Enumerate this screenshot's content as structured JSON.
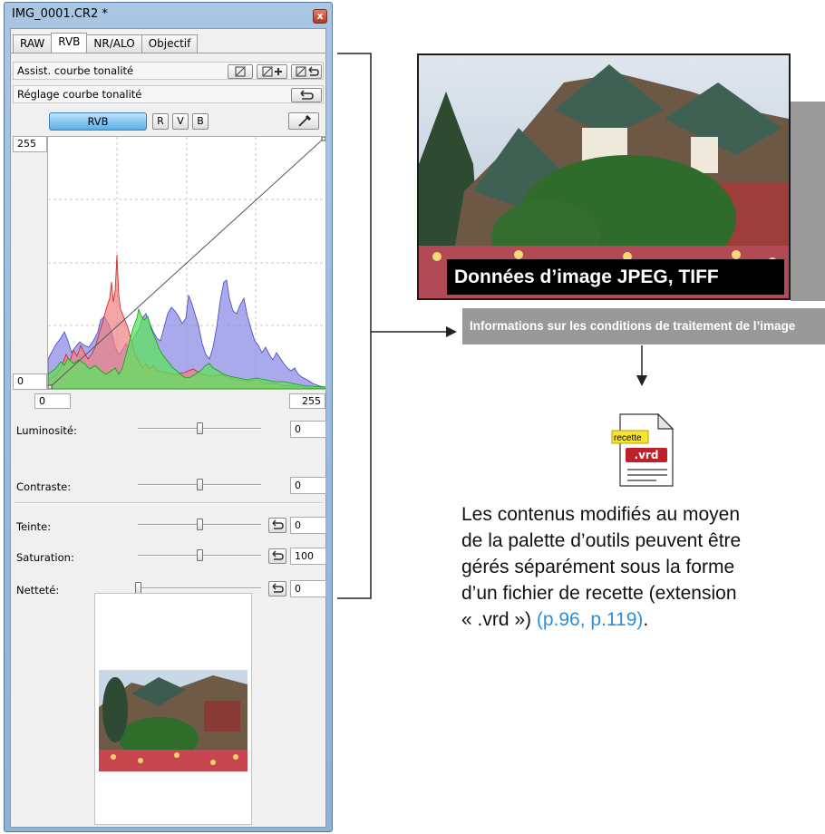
{
  "window": {
    "title": "IMG_0001.CR2 *",
    "close_glyph": "x"
  },
  "tabs": [
    {
      "label": "RAW",
      "active": false
    },
    {
      "label": "RVB",
      "active": true
    },
    {
      "label": "NR/ALO",
      "active": false
    },
    {
      "label": "Objectif",
      "active": false
    }
  ],
  "tone_assist": {
    "label": "Assist. courbe tonalité"
  },
  "tone_adjust": {
    "label": "Réglage courbe tonalité",
    "reset_icon": "undo-arrow-icon"
  },
  "channels": {
    "selected": "RVB",
    "items": [
      "R",
      "V",
      "B"
    ],
    "eyedropper_icon": "eyedropper-icon"
  },
  "curve": {
    "output_max": "255",
    "output_min": "0",
    "input_min": "0",
    "input_max": "255",
    "histogram_colors": {
      "blue": "#8c8ce6",
      "red": "#f08080",
      "green": "#5fe35f"
    }
  },
  "adjustments": [
    {
      "label": "Luminosité:",
      "value": "0",
      "level": 0.5,
      "reset": false
    },
    {
      "label": "Contraste:",
      "value": "0",
      "level": 0.5,
      "reset": false
    },
    {
      "label": "Teinte:",
      "value": "0",
      "level": 0.5,
      "reset": true
    },
    {
      "label": "Saturation:",
      "value": "100",
      "level": 0.5,
      "reset": true
    },
    {
      "label": "Netteté:",
      "value": "0",
      "level": 0.0,
      "reset": true
    }
  ],
  "annotation": {
    "photo_caption": "Données d’image JPEG, TIFF",
    "gray_bar": "Informations sur les conditions de traitement de l’image",
    "recipe_label": "recette",
    "recipe_ext": ".vrd",
    "desc_lines": [
      "Les contenus modifiés au moyen",
      "de la palette d’outils peuvent être",
      "gérés séparément sous la forme",
      "d’un fichier de recette (extension"
    ],
    "desc_last": "« .vrd »)",
    "desc_link": "(p.96, p.119)",
    "desc_end": "."
  },
  "colors": {
    "accent_link": "#2b8ee0",
    "title_bar": "#a9c6e4",
    "selected_channel": "#5aaee8"
  }
}
